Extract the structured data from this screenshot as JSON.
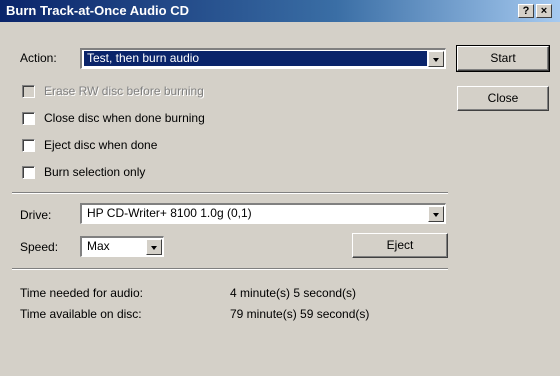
{
  "window": {
    "title": "Burn Track-at-Once Audio CD",
    "help_label": "?",
    "close_label": "×"
  },
  "action": {
    "label": "Action:",
    "value": "Test, then burn audio"
  },
  "buttons": {
    "start": "Start",
    "close": "Close",
    "eject": "Eject"
  },
  "options": [
    {
      "label": "Erase RW disc before burning",
      "checked": false,
      "enabled": false
    },
    {
      "label": "Close disc when done burning",
      "checked": false,
      "enabled": true
    },
    {
      "label": "Eject disc when done",
      "checked": false,
      "enabled": true
    },
    {
      "label": "Burn selection only",
      "checked": false,
      "enabled": true
    }
  ],
  "drive": {
    "label": "Drive:",
    "value": "HP CD-Writer+ 8100 1.0g (0,1)"
  },
  "speed": {
    "label": "Speed:",
    "value": "Max"
  },
  "info": {
    "needed_label": "Time needed for audio:",
    "needed_value": "4 minute(s) 5 second(s)",
    "available_label": "Time available on disc:",
    "available_value": "79 minute(s) 59 second(s)"
  }
}
